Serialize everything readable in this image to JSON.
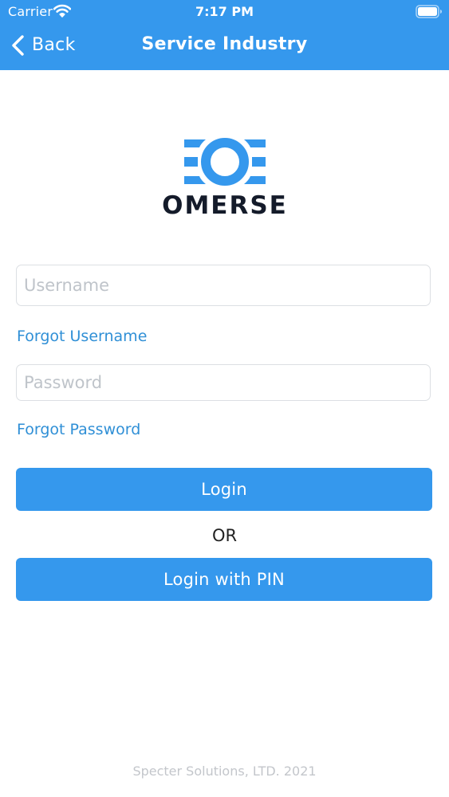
{
  "status_bar": {
    "carrier": "Carrier",
    "time": "7:17 PM",
    "wifi_icon": "wifi-icon",
    "battery_icon": "battery-icon"
  },
  "nav": {
    "back_label": "Back",
    "back_icon": "chevron-left-icon",
    "title": "Service Industry"
  },
  "logo": {
    "wordmark": "OMERSE"
  },
  "form": {
    "username_placeholder": "Username",
    "username_value": "",
    "forgot_username": "Forgot Username",
    "password_placeholder": "Password",
    "password_value": "",
    "forgot_password": "Forgot Password",
    "login_label": "Login",
    "or_label": "OR",
    "login_pin_label": "Login with PIN"
  },
  "footer": {
    "text": "Specter Solutions, LTD. 2021"
  },
  "colors": {
    "accent": "#3598ed",
    "link": "#2f8fd6",
    "logo_dark": "#141b2a",
    "field_border": "#dcdfe3",
    "placeholder": "#bfc4ca",
    "footer_text": "#c3c6cb"
  }
}
